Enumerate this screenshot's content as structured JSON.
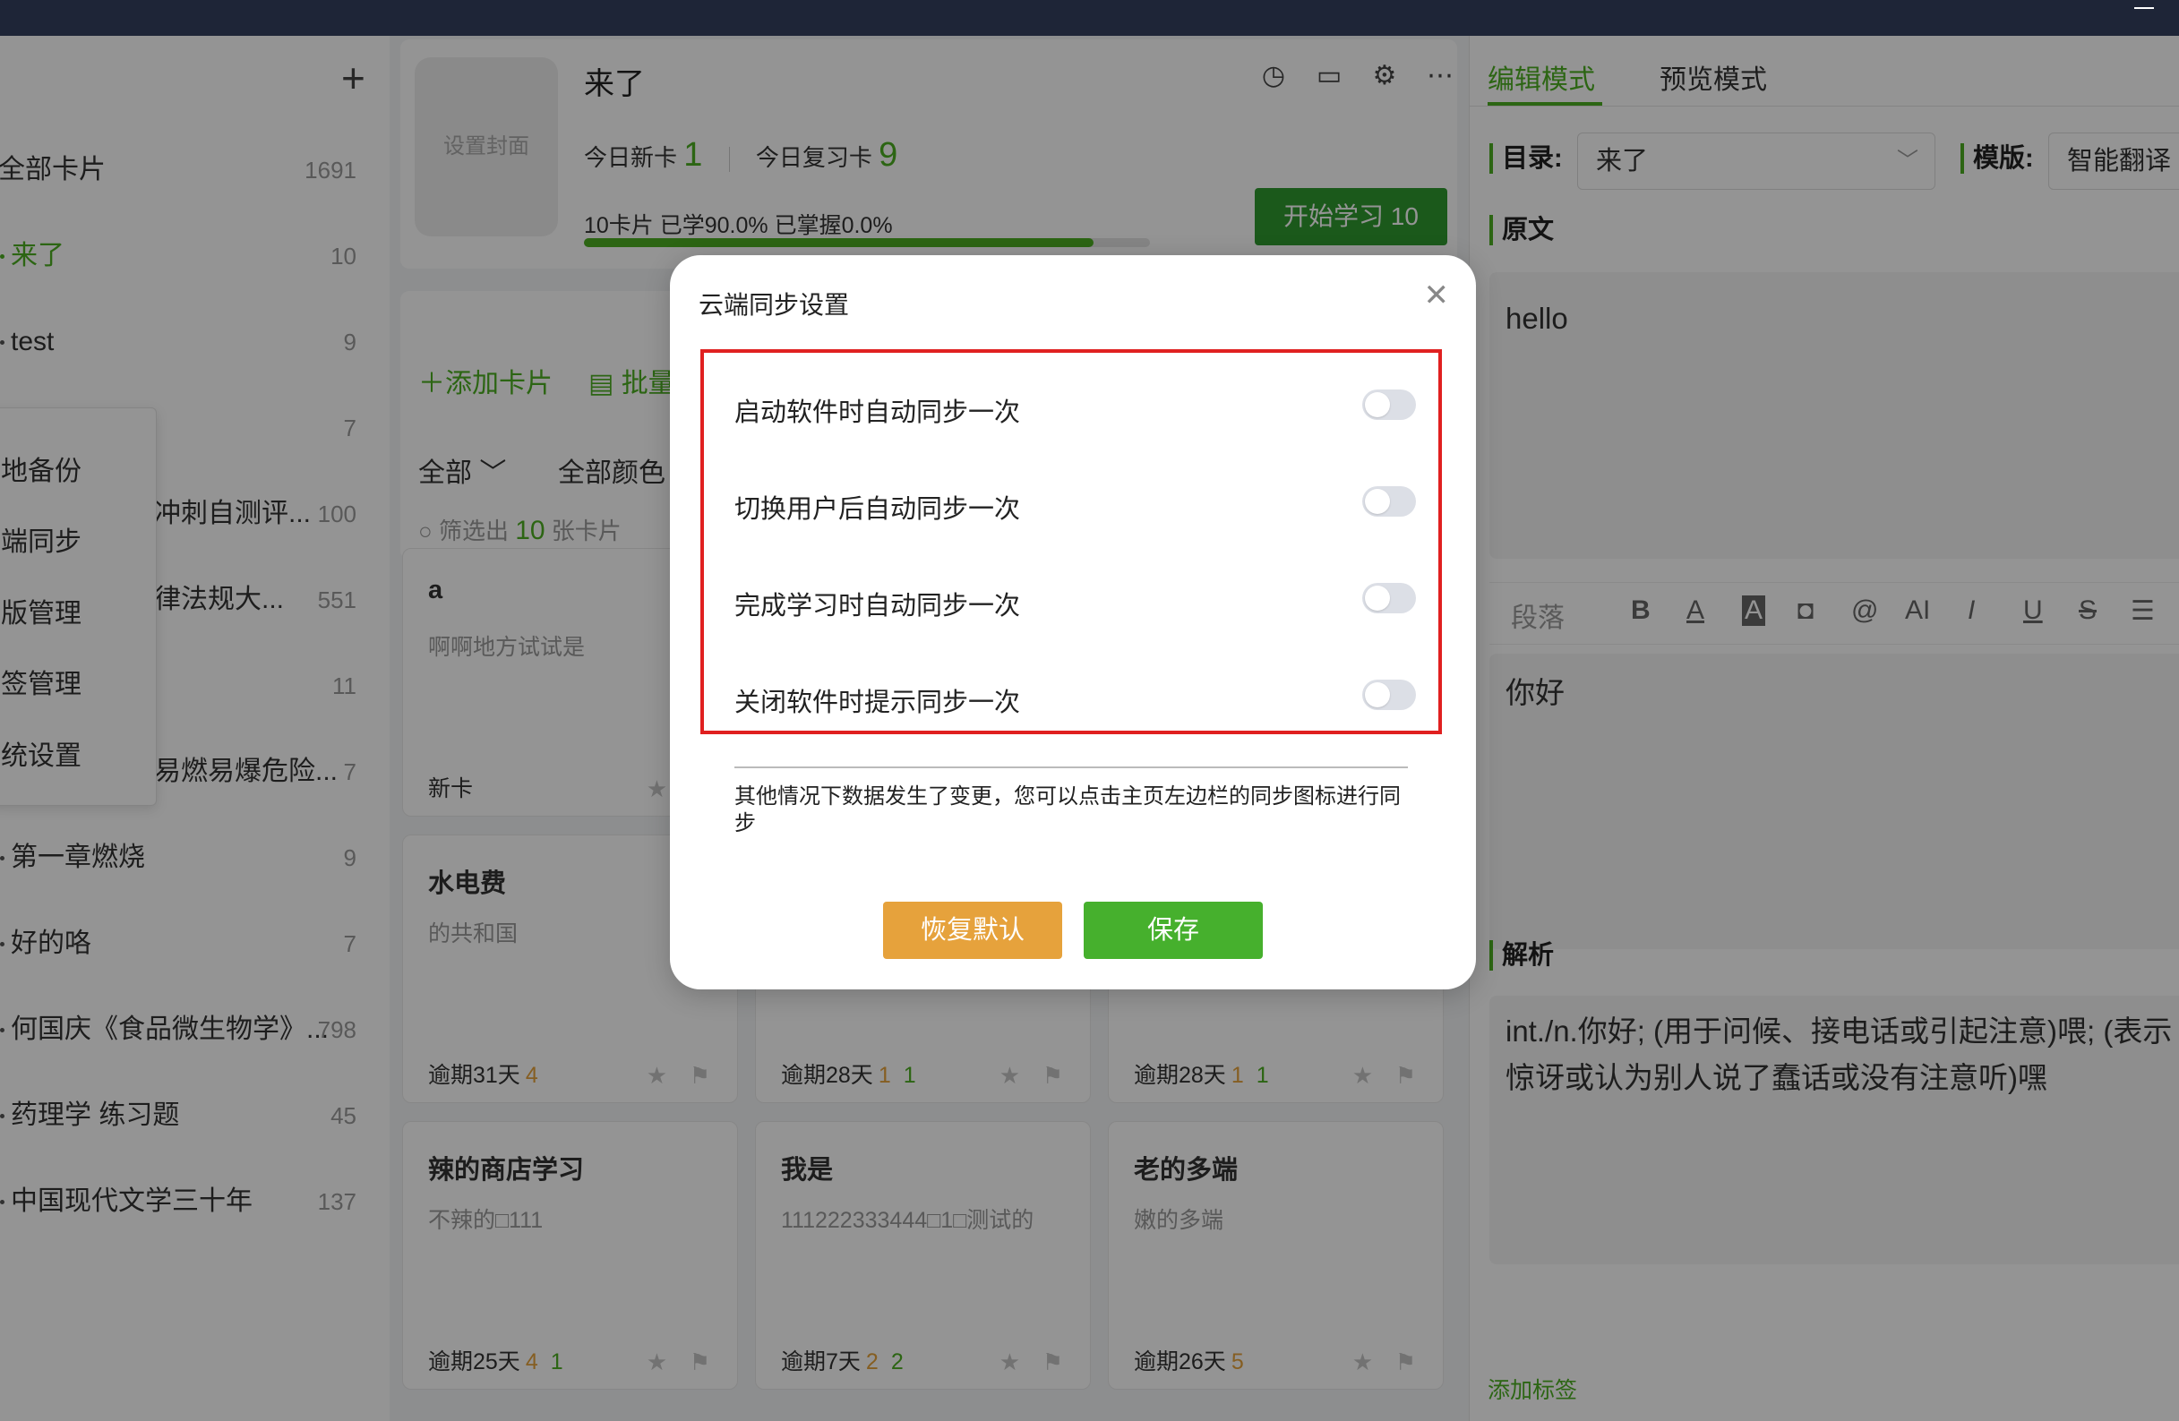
{
  "sidebar": {
    "add_label": "+",
    "decks": [
      {
        "name": "全部卡片",
        "count": "1691",
        "active": false
      },
      {
        "name": "来了",
        "count": "10",
        "active": true
      },
      {
        "name": "test",
        "count": "9",
        "active": false
      },
      {
        "name": "",
        "count": "7",
        "active": false
      },
      {
        "name": "冲刺自测评...",
        "count": "100",
        "active": false
      },
      {
        "name": "律法规大...",
        "count": "551",
        "active": false
      },
      {
        "name": "",
        "count": "11",
        "active": false
      },
      {
        "name": "易燃易爆危险...",
        "count": "7",
        "active": false
      },
      {
        "name": "第一章燃烧",
        "count": "9",
        "active": false
      },
      {
        "name": "好的咯",
        "count": "7",
        "active": false
      },
      {
        "name": "何国庆《食品微生物学》...",
        "count": "798",
        "active": false
      },
      {
        "name": "药理学 练习题",
        "count": "45",
        "active": false
      },
      {
        "name": "中国现代文学三十年",
        "count": "137",
        "active": false
      }
    ],
    "menu_items": [
      "地备份",
      "端同步",
      "版管理",
      "签管理",
      "统设置"
    ]
  },
  "deck_header": {
    "cover_label": "设置封面",
    "title": "来了",
    "today_new_label": "今日新卡",
    "today_new": "1",
    "today_review_label": "今日复习卡",
    "today_review": "9",
    "progress_text": "10卡片   已学90.0%   已掌握0.0%",
    "progress": 0.9,
    "start_button": "开始学习 10",
    "icons": [
      "clock-icon",
      "presentation-icon",
      "gear-icon",
      "more-icon"
    ]
  },
  "toolbar": {
    "add_card": "＋添加卡片",
    "batch": "批量",
    "filter_all": "全部",
    "filter_color": "全部颜色",
    "search_prefix": "筛选出",
    "search_count": "10",
    "search_suffix": "张卡片"
  },
  "cards": [
    {
      "title": "a",
      "body": "啊啊地方试试是",
      "foot": "新卡",
      "orange": "",
      "green": ""
    },
    {
      "title": "水电费",
      "body": "的共和国",
      "foot": "逾期31天",
      "orange": "4",
      "green": ""
    },
    {
      "title": "",
      "body": "",
      "foot": "逾期28天",
      "orange": "1",
      "green": "1"
    },
    {
      "title": "",
      "body": "",
      "foot": "逾期28天",
      "orange": "1",
      "green": "1"
    },
    {
      "title": "辣的商店学习",
      "body": "不辣的□111",
      "foot": "逾期25天",
      "orange": "4",
      "green": "1"
    },
    {
      "title": "我是",
      "body": "111222333444□1□测试的",
      "foot": "逾期7天",
      "orange": "2",
      "green": "2"
    },
    {
      "title": "老的多端",
      "body": "嫩的多端",
      "foot": "逾期26天",
      "orange": "5",
      "green": ""
    }
  ],
  "editor": {
    "tab_edit": "编辑模式",
    "tab_preview": "预览模式",
    "dir_label": "目录:",
    "dir_value": "来了",
    "template_label": "模版:",
    "template_value": "智能翻译",
    "front_label": "原文",
    "front_text": "hello",
    "format_paragraph": "段落",
    "back_text": "你好",
    "analysis_label": "解析",
    "analysis_text": "int./n.你好; (用于问候、接电话或引起注意)喂; (表示惊讶或认为别人说了蠢话或没有注意听)嘿",
    "add_tag": "添加标签"
  },
  "modal": {
    "title": "云端同步设置",
    "options": [
      {
        "label": "启动软件时自动同步一次",
        "enabled": false
      },
      {
        "label": "切换用户后自动同步一次",
        "enabled": false
      },
      {
        "label": "完成学习时自动同步一次",
        "enabled": false
      },
      {
        "label": "关闭软件时提示同步一次",
        "enabled": false
      }
    ],
    "note": "其他情况下数据发生了变更，您可以点击主页左边栏的同步图标进行同步",
    "reset_button": "恢复默认",
    "save_button": "保存"
  }
}
